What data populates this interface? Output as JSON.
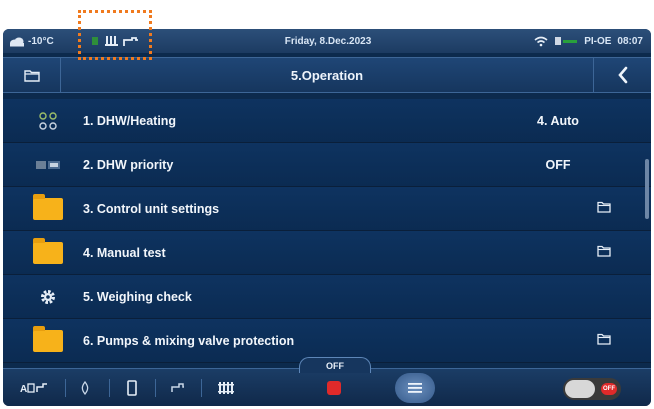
{
  "status_bar": {
    "outdoor_temp": "-10°C",
    "date": "Friday, 8.Dec.2023",
    "language": "PI-OE",
    "time": "08:07"
  },
  "title_bar": {
    "title": "5.Operation"
  },
  "menu": {
    "items": [
      {
        "label": "1.  DHW/Heating",
        "value": "4. Auto",
        "icon": "dots-grid-icon"
      },
      {
        "label": "2.  DHW priority",
        "value": "OFF",
        "icon": "priority-icon"
      },
      {
        "label": "3.  Control unit settings",
        "value": "",
        "icon": "folder-icon",
        "submenu": true
      },
      {
        "label": "4.  Manual test",
        "value": "",
        "icon": "folder-icon",
        "submenu": true
      },
      {
        "label": "5.  Weighing check",
        "value": "",
        "icon": "gear-icon"
      },
      {
        "label": "6.  Pumps & mixing valve protection",
        "value": "",
        "icon": "folder-icon",
        "submenu": true
      }
    ]
  },
  "bottom_bar": {
    "off_label": "OFF",
    "toggle_label": "OFF"
  },
  "colors": {
    "accent_orange": "#f07a1e",
    "folder_yellow": "#f7b21a",
    "stop_red": "#e02a2a",
    "panel_blue": "#0c2a4d"
  }
}
